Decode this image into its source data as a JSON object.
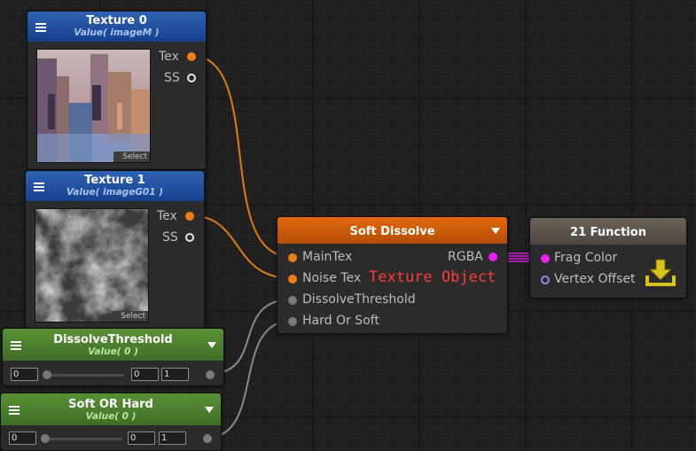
{
  "nodes": {
    "texture0": {
      "title": "Texture 0",
      "subtitle": "Value( imageM )",
      "out_tex": "Tex",
      "out_ss": "SS",
      "select": "Select"
    },
    "texture1": {
      "title": "Texture 1",
      "subtitle": "Value( imageG01 )",
      "out_tex": "Tex",
      "out_ss": "SS",
      "select": "Select"
    },
    "dissolve_threshold": {
      "title": "DissolveThreshold",
      "subtitle": "Value( 0 )",
      "value": "0",
      "min": "0",
      "max": "1",
      "slider_fraction": 0
    },
    "soft_or_hard": {
      "title": "Soft OR Hard",
      "subtitle": "Value( 0 )",
      "value": "0",
      "min": "0",
      "max": "1",
      "slider_fraction": 0
    },
    "soft_dissolve": {
      "title": "Soft Dissolve",
      "inputs": [
        "MainTex",
        "Noise Tex",
        "DissolveThreshold",
        "Hard Or Soft"
      ],
      "output": "RGBA"
    },
    "function": {
      "title": "21 Function",
      "inputs": [
        "Frag Color",
        "Vertex Offset"
      ]
    }
  },
  "annotation": "Texture Object",
  "colors": {
    "texture_wire": "#e07a12",
    "float_wire": "#8a8a8a",
    "color_wire": "#d21fd6",
    "texture_header": "#1f4fa0",
    "value_header": "#4f842f",
    "function_header": "#c85a08",
    "output_header": "#5c544b",
    "annotation": "#ff3b3b"
  },
  "icons": {
    "node_menu": "hamburger-icon",
    "collapse": "triangle-down-icon",
    "master_output": "download-tray-icon"
  }
}
